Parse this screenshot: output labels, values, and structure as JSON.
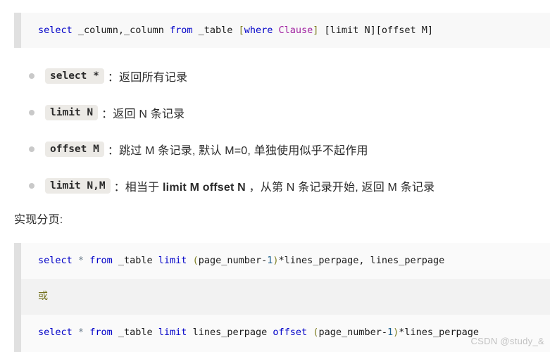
{
  "code_block_1": {
    "name": "sql-syntax-code-block",
    "lines": [
      {
        "tokens": [
          {
            "t": "select",
            "c": "kw"
          },
          {
            "t": " ",
            "c": "plain"
          },
          {
            "t": "_column,_column",
            "c": "plain"
          },
          {
            "t": " ",
            "c": "plain"
          },
          {
            "t": "from",
            "c": "kw"
          },
          {
            "t": " ",
            "c": "plain"
          },
          {
            "t": "_table",
            "c": "plain"
          },
          {
            "t": " ",
            "c": "plain"
          },
          {
            "t": "[",
            "c": "br"
          },
          {
            "t": "where",
            "c": "kw"
          },
          {
            "t": " ",
            "c": "plain"
          },
          {
            "t": "Clause",
            "c": "type"
          },
          {
            "t": "]",
            "c": "br"
          },
          {
            "t": " ",
            "c": "plain"
          },
          {
            "t": "[limit N][offset M]",
            "c": "plain"
          }
        ]
      }
    ]
  },
  "bullets": [
    {
      "code": "select *",
      "text": "：返回所有记录"
    },
    {
      "code": "limit N",
      "text": "：返回 N 条记录"
    },
    {
      "code": "offset M",
      "text": "：跳过 M 条记录, 默认 M=0, 单独使用似乎不起作用"
    },
    {
      "code": "limit N,M",
      "text_pre": "：相当于 ",
      "text_bold": "limit M offset N",
      "text_post": " ，从第 N 条记录开始, 返回 M 条记录"
    }
  ],
  "section_heading": "实现分页:",
  "code_block_2": {
    "name": "pagination-code-block",
    "lines": [
      {
        "alt": false,
        "tokens": [
          {
            "t": "select",
            "c": "kw"
          },
          {
            "t": " ",
            "c": "plain"
          },
          {
            "t": "*",
            "c": "star"
          },
          {
            "t": " ",
            "c": "plain"
          },
          {
            "t": "from",
            "c": "kw"
          },
          {
            "t": " ",
            "c": "plain"
          },
          {
            "t": "_table",
            "c": "plain"
          },
          {
            "t": " ",
            "c": "plain"
          },
          {
            "t": "limit",
            "c": "kw"
          },
          {
            "t": " ",
            "c": "plain"
          },
          {
            "t": "(",
            "c": "punct"
          },
          {
            "t": "page_number",
            "c": "plain"
          },
          {
            "t": "-",
            "c": "plain"
          },
          {
            "t": "1",
            "c": "num"
          },
          {
            "t": ")",
            "c": "punct"
          },
          {
            "t": "*lines_perpage, lines_perpage",
            "c": "plain"
          }
        ]
      },
      {
        "alt": true,
        "tokens": [
          {
            "t": "或",
            "c": "or"
          }
        ]
      },
      {
        "alt": false,
        "tokens": [
          {
            "t": "select",
            "c": "kw"
          },
          {
            "t": " ",
            "c": "plain"
          },
          {
            "t": "*",
            "c": "star"
          },
          {
            "t": " ",
            "c": "plain"
          },
          {
            "t": "from",
            "c": "kw"
          },
          {
            "t": " ",
            "c": "plain"
          },
          {
            "t": "_table",
            "c": "plain"
          },
          {
            "t": " ",
            "c": "plain"
          },
          {
            "t": "limit",
            "c": "kw"
          },
          {
            "t": " ",
            "c": "plain"
          },
          {
            "t": "lines_perpage",
            "c": "plain"
          },
          {
            "t": " ",
            "c": "plain"
          },
          {
            "t": "offset",
            "c": "kw"
          },
          {
            "t": " ",
            "c": "plain"
          },
          {
            "t": "(",
            "c": "punct"
          },
          {
            "t": "page_number",
            "c": "plain"
          },
          {
            "t": "-",
            "c": "plain"
          },
          {
            "t": "1",
            "c": "num"
          },
          {
            "t": ")",
            "c": "punct"
          },
          {
            "t": "*lines_perpage",
            "c": "plain"
          }
        ]
      }
    ]
  },
  "watermark": "CSDN @study_&",
  "colors": {
    "keyword": "#0000c8",
    "bracket": "#7d7d20",
    "type": "#a020a0",
    "number": "#1c5f8c",
    "or_text": "#73701c",
    "bullet_dot": "#c9c9c9",
    "inline_code_bg": "#eceae6",
    "code_bg": "#f7f7f7",
    "gutter": "#e0e0e0",
    "watermark": "#c2c2c2"
  }
}
